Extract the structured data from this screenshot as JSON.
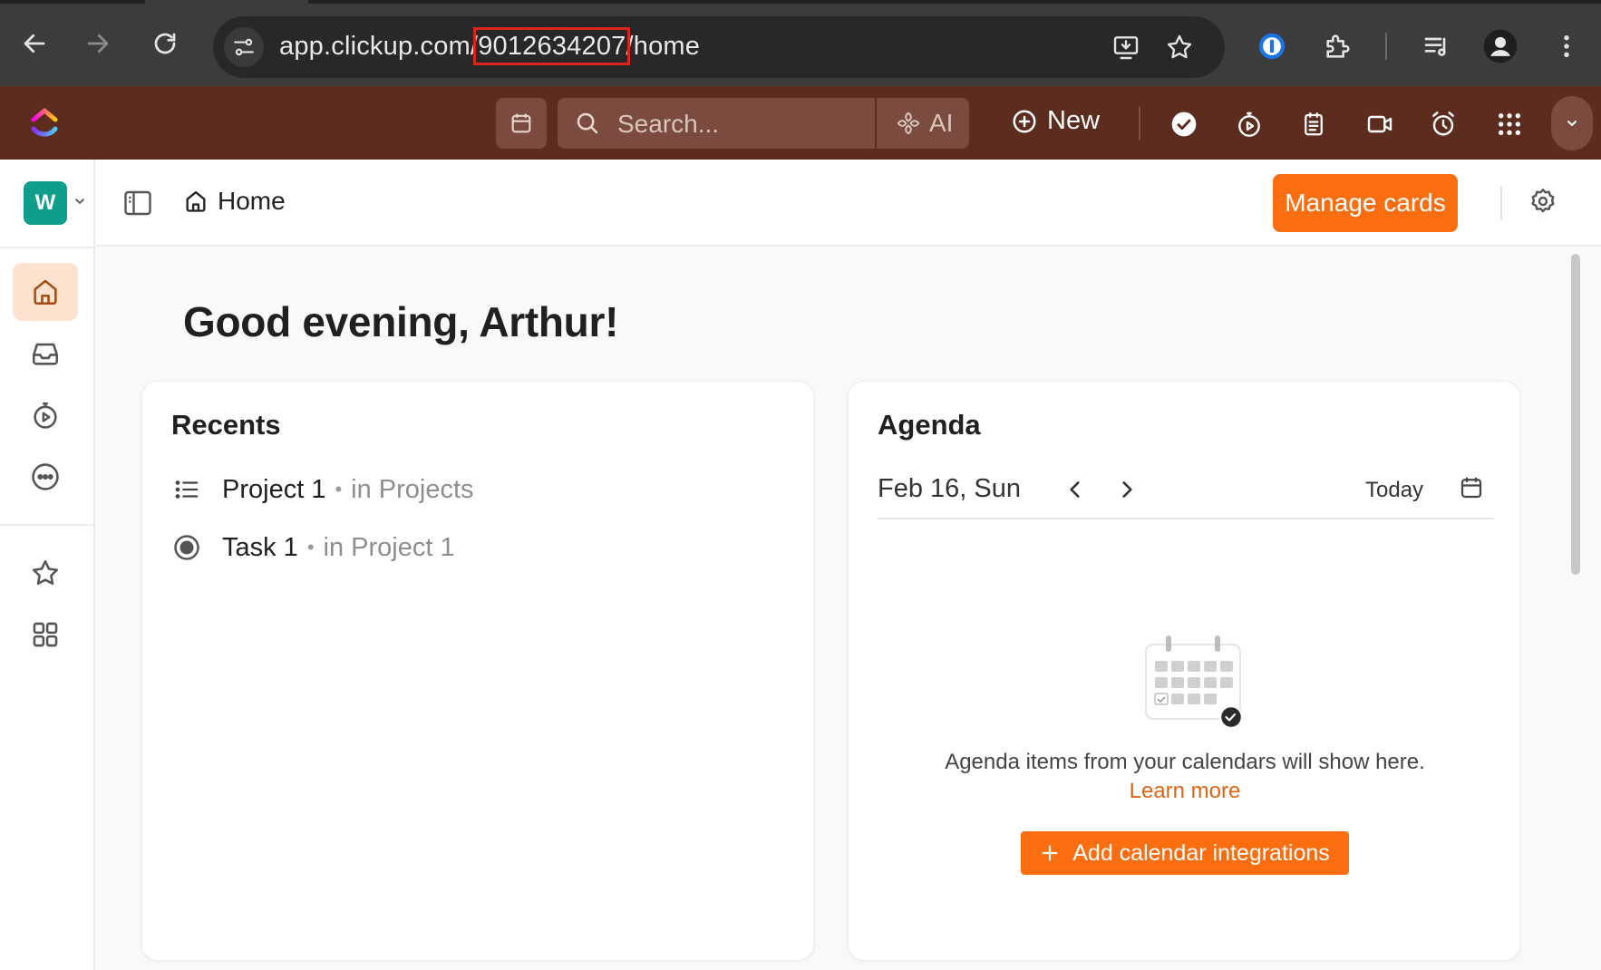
{
  "browser": {
    "url_prefix": "app.clickup.com/",
    "url_highlight": "9012634207",
    "url_suffix": "/home",
    "icons": [
      "back-icon",
      "forward-icon",
      "reload-icon",
      "site-info-icon",
      "install-app-icon",
      "bookmark-star-icon",
      "password-manager-icon",
      "extensions-icon",
      "media-controls-icon",
      "profile-icon",
      "chrome-menu-icon"
    ],
    "highlight_color": "#d8251f"
  },
  "topbar": {
    "search_placeholder": "Search...",
    "ai_label": "AI",
    "new_label": "New",
    "icons": [
      "calendar-icon",
      "search-icon",
      "ai-icon",
      "plus-circle-icon",
      "check-circle-icon",
      "timer-icon",
      "notepad-icon",
      "video-icon",
      "alarm-clock-icon",
      "apps-grid-icon",
      "chevron-down-icon"
    ],
    "background_color": "#5c2c1e"
  },
  "sidebar": {
    "workspace_initial": "W",
    "workspace_color": "#0f9d8c",
    "items": [
      {
        "name": "home",
        "icon": "home-icon",
        "active": true
      },
      {
        "name": "inbox",
        "icon": "inbox-icon",
        "active": false
      },
      {
        "name": "timesheets",
        "icon": "timer-play-icon",
        "active": false
      },
      {
        "name": "more",
        "icon": "more-dots-icon",
        "active": false
      },
      {
        "name": "favorites",
        "icon": "star-icon",
        "active": false
      },
      {
        "name": "spaces",
        "icon": "grid-icon",
        "active": false
      }
    ]
  },
  "header": {
    "breadcrumb": "Home",
    "manage_cards_label": "Manage cards",
    "accent_color": "#fa6e10"
  },
  "main": {
    "greeting": "Good evening, Arthur!",
    "recents": {
      "title": "Recents",
      "items": [
        {
          "name": "Project 1",
          "location": "in Projects",
          "icon": "list-icon"
        },
        {
          "name": "Task 1",
          "location": "in Project 1",
          "icon": "task-status-icon"
        }
      ]
    },
    "agenda": {
      "title": "Agenda",
      "date": "Feb 16, Sun",
      "today_label": "Today",
      "empty_text": "Agenda items from your calendars will show here.",
      "learn_more": "Learn more",
      "add_button": "Add calendar integrations"
    }
  }
}
